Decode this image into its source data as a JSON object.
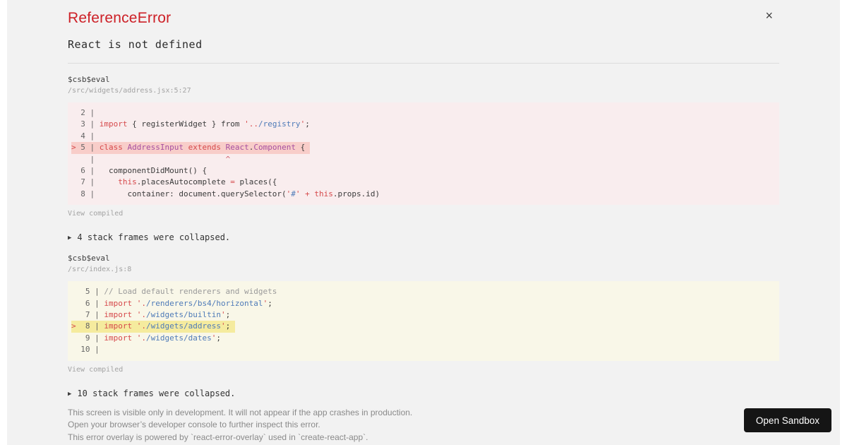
{
  "palette": {
    "title_red": "#cd2027",
    "keyword_red": "#d6494b",
    "path_blue": "#4f7bb8",
    "class_purple": "#a64fa0",
    "comment_gray": "#9a9a9a",
    "error_block_bg": "#f9edee",
    "error_line_bg": "#f8cdc9",
    "warning_block_bg": "#f9f7e8",
    "warning_line_bg": "#f5eb9e",
    "panel_bg": "#f2f2f2",
    "button_bg": "#151515"
  },
  "header": {
    "title": "ReferenceError",
    "message": "React is not defined",
    "close_icon": "×"
  },
  "frames": [
    {
      "fn": "$csb$eval",
      "loc": "/src/widgets/address.jsx:5:27",
      "view_compiled_label": "View compiled",
      "variant": "error",
      "code": [
        {
          "hl": null,
          "seg": [
            {
              "c": "g",
              "t": "  2 | "
            }
          ]
        },
        {
          "hl": null,
          "seg": [
            {
              "c": "g",
              "t": "  3 | "
            },
            {
              "c": "kw",
              "t": "import"
            },
            {
              "c": "pl",
              "t": " { registerWidget } from "
            },
            {
              "c": "str",
              "t": "'.."
            },
            {
              "c": "path",
              "t": "/registry"
            },
            {
              "c": "str",
              "t": "'"
            },
            {
              "c": "pl",
              "t": ";"
            }
          ]
        },
        {
          "hl": null,
          "seg": [
            {
              "c": "g",
              "t": "  4 | "
            }
          ]
        },
        {
          "hl": "error",
          "seg": [
            {
              "c": "mark",
              "t": "> "
            },
            {
              "c": "g",
              "t": "5 | "
            },
            {
              "c": "kw",
              "t": "class"
            },
            {
              "c": "pl",
              "t": " "
            },
            {
              "c": "cls",
              "t": "AddressInput"
            },
            {
              "c": "pl",
              "t": " "
            },
            {
              "c": "kw",
              "t": "extends"
            },
            {
              "c": "pl",
              "t": " "
            },
            {
              "c": "cls",
              "t": "React"
            },
            {
              "c": "pl",
              "t": "."
            },
            {
              "c": "cls",
              "t": "Component"
            },
            {
              "c": "pl",
              "t": " { "
            }
          ]
        },
        {
          "hl": null,
          "seg": [
            {
              "c": "g",
              "t": "    | "
            },
            {
              "c": "pl",
              "t": "                           "
            },
            {
              "c": "caret",
              "t": "^"
            }
          ]
        },
        {
          "hl": null,
          "seg": [
            {
              "c": "g",
              "t": "  6 | "
            },
            {
              "c": "pl",
              "t": "  componentDidMount() {"
            }
          ]
        },
        {
          "hl": null,
          "seg": [
            {
              "c": "g",
              "t": "  7 | "
            },
            {
              "c": "pl",
              "t": "    "
            },
            {
              "c": "kw",
              "t": "this"
            },
            {
              "c": "pl",
              "t": ".placesAutocomplete "
            },
            {
              "c": "op",
              "t": "="
            },
            {
              "c": "pl",
              "t": " places({"
            }
          ]
        },
        {
          "hl": null,
          "seg": [
            {
              "c": "g",
              "t": "  8 | "
            },
            {
              "c": "pl",
              "t": "      container: document.querySelector("
            },
            {
              "c": "str",
              "t": "'"
            },
            {
              "c": "path",
              "t": "#"
            },
            {
              "c": "str",
              "t": "'"
            },
            {
              "c": "pl",
              "t": " "
            },
            {
              "c": "op",
              "t": "+"
            },
            {
              "c": "pl",
              "t": " "
            },
            {
              "c": "kw",
              "t": "this"
            },
            {
              "c": "pl",
              "t": ".props.id)"
            }
          ]
        }
      ]
    },
    {
      "fn": "$csb$eval",
      "loc": "/src/index.js:8",
      "view_compiled_label": "View compiled",
      "variant": "warning",
      "code": [
        {
          "hl": null,
          "seg": [
            {
              "c": "g",
              "t": "   5 | "
            },
            {
              "c": "cmt",
              "t": "// Load default renderers and widgets"
            }
          ]
        },
        {
          "hl": null,
          "seg": [
            {
              "c": "g",
              "t": "   6 | "
            },
            {
              "c": "kw",
              "t": "import"
            },
            {
              "c": "pl",
              "t": " "
            },
            {
              "c": "str",
              "t": "'."
            },
            {
              "c": "path",
              "t": "/renderers/bs4/horizontal"
            },
            {
              "c": "str",
              "t": "'"
            },
            {
              "c": "pl",
              "t": ";"
            }
          ]
        },
        {
          "hl": null,
          "seg": [
            {
              "c": "g",
              "t": "   7 | "
            },
            {
              "c": "kw",
              "t": "import"
            },
            {
              "c": "pl",
              "t": " "
            },
            {
              "c": "str",
              "t": "'."
            },
            {
              "c": "path",
              "t": "/widgets/builtin"
            },
            {
              "c": "str",
              "t": "'"
            },
            {
              "c": "pl",
              "t": ";"
            }
          ]
        },
        {
          "hl": "warning",
          "seg": [
            {
              "c": "mark",
              "t": ">"
            },
            {
              "c": "g",
              "t": "  8 | "
            },
            {
              "c": "kw",
              "t": "import"
            },
            {
              "c": "pl",
              "t": " "
            },
            {
              "c": "str",
              "t": "'."
            },
            {
              "c": "path",
              "t": "/widgets/address"
            },
            {
              "c": "str",
              "t": "'"
            },
            {
              "c": "pl",
              "t": "; "
            }
          ]
        },
        {
          "hl": null,
          "seg": [
            {
              "c": "g",
              "t": "   9 | "
            },
            {
              "c": "kw",
              "t": "import"
            },
            {
              "c": "pl",
              "t": " "
            },
            {
              "c": "str",
              "t": "'."
            },
            {
              "c": "path",
              "t": "/widgets/dates"
            },
            {
              "c": "str",
              "t": "'"
            },
            {
              "c": "pl",
              "t": ";"
            }
          ]
        },
        {
          "hl": null,
          "seg": [
            {
              "c": "g",
              "t": "  10 | "
            }
          ]
        }
      ]
    }
  ],
  "collapsed_rows": [
    {
      "icon": "▶",
      "label": "4 stack frames were collapsed."
    },
    {
      "icon": "▶",
      "label": "10 stack frames were collapsed."
    }
  ],
  "footer": {
    "lines": [
      "This screen is visible only in development. It will not appear if the app crashes in production.",
      "Open your browser’s developer console to further inspect this error.",
      "This error overlay is powered by `react-error-overlay` used in `create-react-app`."
    ],
    "open_sandbox_label": "Open Sandbox"
  }
}
